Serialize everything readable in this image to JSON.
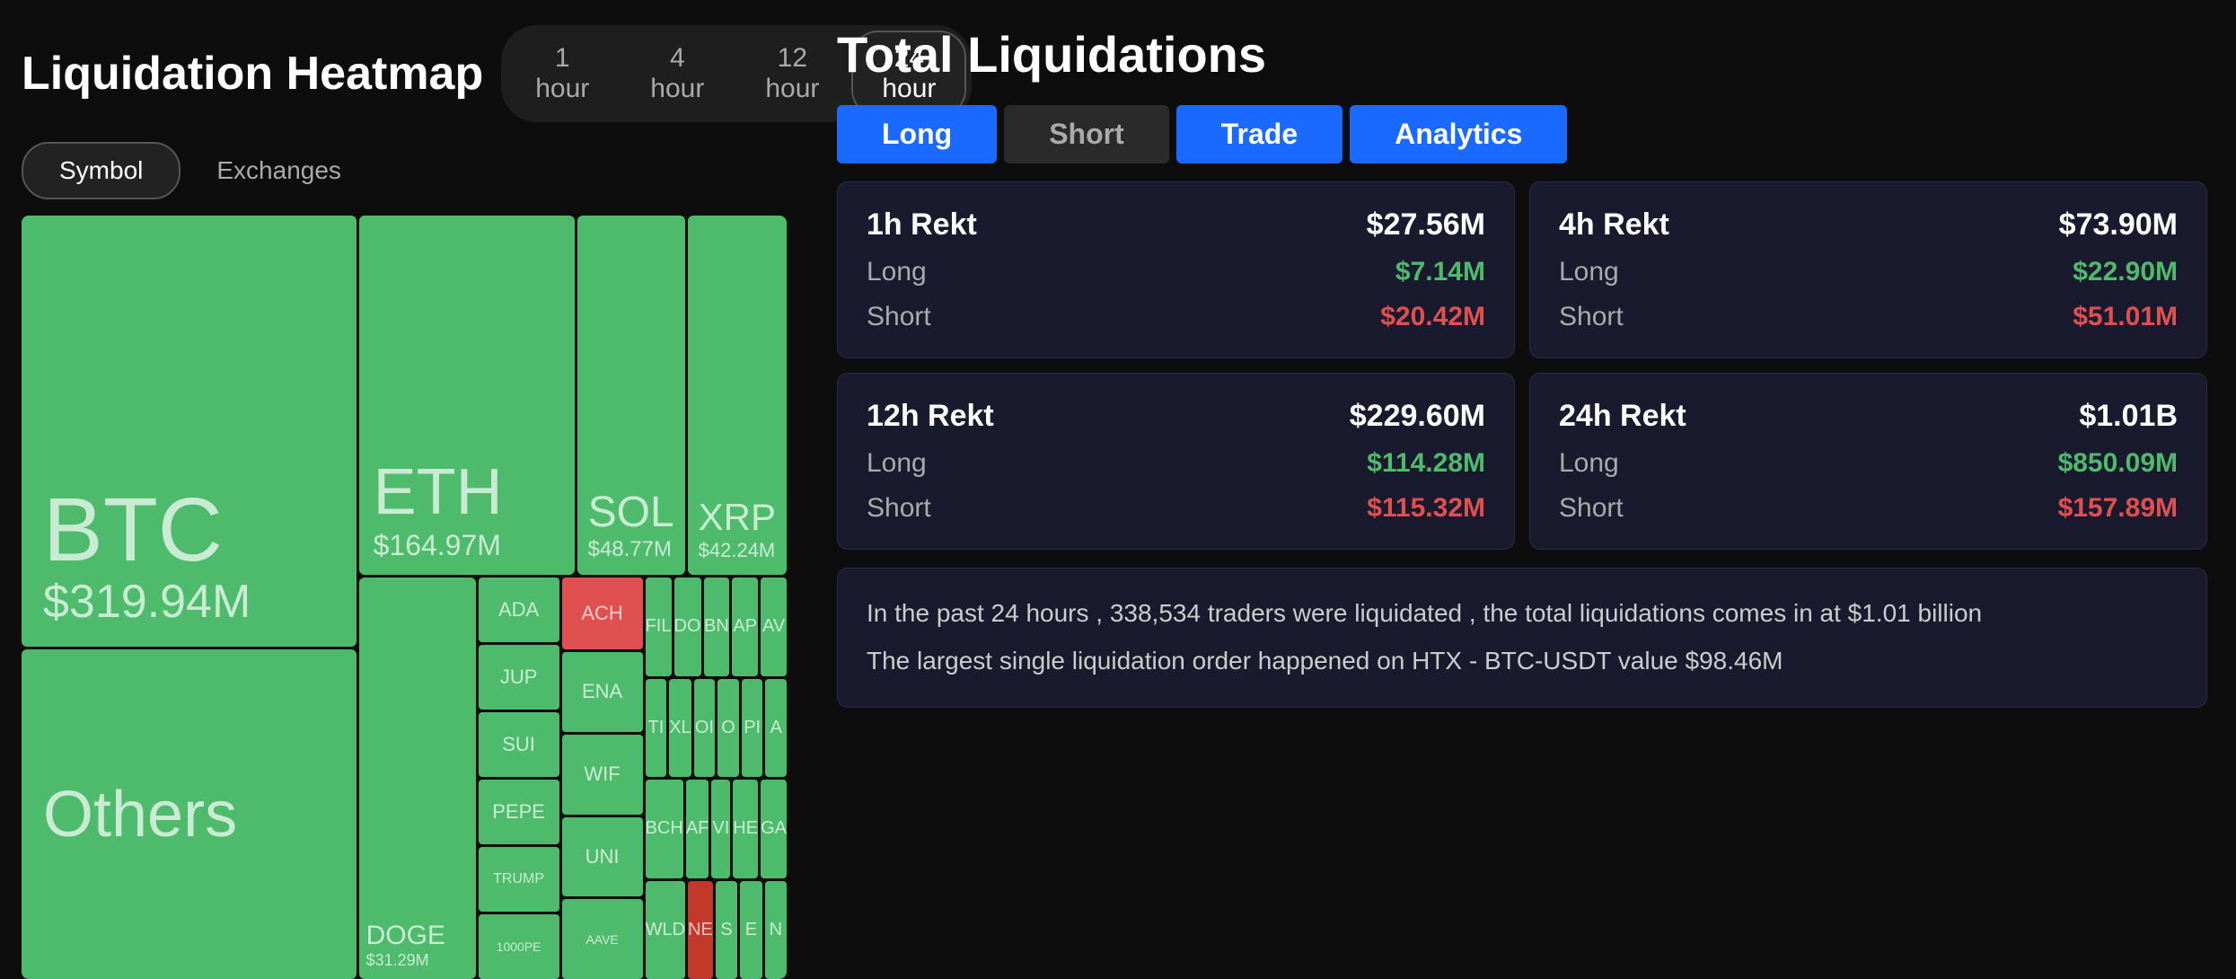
{
  "app": {
    "title": "Liquidation Heatmap"
  },
  "timeButtons": [
    {
      "label": "1 hour",
      "active": false
    },
    {
      "label": "4 hour",
      "active": false
    },
    {
      "label": "12 hour",
      "active": false
    },
    {
      "label": "24 hour",
      "active": true
    }
  ],
  "filterButtons": [
    {
      "label": "Symbol",
      "active": true
    },
    {
      "label": "Exchanges",
      "active": false
    }
  ],
  "heatmap": {
    "btc": {
      "label": "BTC",
      "value": "$319.94M"
    },
    "others": {
      "label": "Others"
    },
    "eth": {
      "label": "ETH",
      "value": "$164.97M"
    },
    "sol": {
      "label": "SOL",
      "value": "$48.77M"
    },
    "xrp": {
      "label": "XRP",
      "value": "$42.24M"
    },
    "doge": {
      "label": "DOGE",
      "value": "$31.29M"
    },
    "cells": [
      "ADA",
      "JUP",
      "SUI",
      "PEPE",
      "TRUMP",
      "1000PE",
      "ACH",
      "ENA",
      "WIF",
      "UNI",
      "FIL",
      "TI",
      "BCH",
      "WLD",
      "AAVE",
      "DO",
      "XL",
      "AF",
      "NE",
      "BN",
      "OI",
      "VI",
      "S",
      "AP",
      "O",
      "HE",
      "E",
      "AV",
      "PI",
      "GA",
      "A",
      "N"
    ]
  },
  "totalLiquidations": {
    "title": "Total Liquidations",
    "tabs": [
      "Long",
      "Short",
      "Trade",
      "Analytics"
    ],
    "activeTab": "Analytics",
    "cards": [
      {
        "id": "1h",
        "title": "1h Rekt",
        "titleValue": "$27.56M",
        "longLabel": "Long",
        "longValue": "$7.14M",
        "shortLabel": "Short",
        "shortValue": "$20.42M"
      },
      {
        "id": "4h",
        "title": "4h Rekt",
        "titleValue": "$73.90M",
        "longLabel": "Long",
        "longValue": "$22.90M",
        "shortLabel": "Short",
        "shortValue": "$51.01M"
      },
      {
        "id": "12h",
        "title": "12h Rekt",
        "titleValue": "$229.60M",
        "longLabel": "Long",
        "longValue": "$114.28M",
        "shortLabel": "Short",
        "shortValue": "$115.32M"
      },
      {
        "id": "24h",
        "title": "24h Rekt",
        "titleValue": "$1.01B",
        "longLabel": "Long",
        "longValue": "$850.09M",
        "shortLabel": "Short",
        "shortValue": "$157.89M"
      }
    ],
    "infoLines": [
      "In the past 24 hours , 338,534 traders were liquidated , the total liquidations comes in at $1.01 billion",
      "The largest single liquidation order happened on HTX - BTC-USDT value $98.46M"
    ]
  }
}
